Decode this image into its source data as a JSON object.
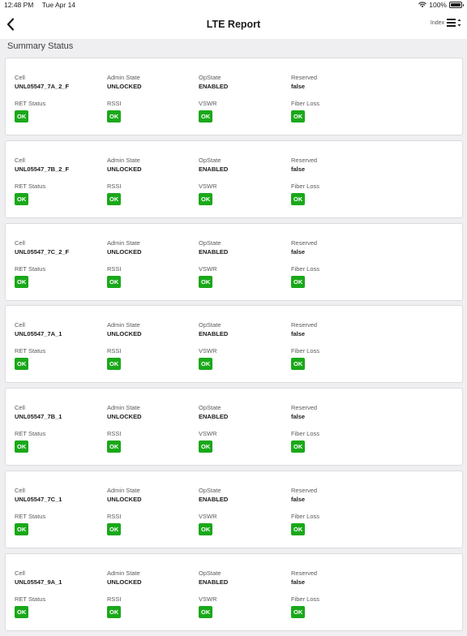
{
  "statusbar": {
    "time": "12:48 PM",
    "date": "Tue Apr 14",
    "battery": "100%"
  },
  "navbar": {
    "title": "LTE Report",
    "index_label": "Index"
  },
  "section_title": "Summary Status",
  "labels": {
    "cell": "Cell",
    "admin_state": "Admin State",
    "opstate": "OpState",
    "reserved": "Reserved",
    "ret_status": "RET Status",
    "rssi": "RSSI",
    "vswr": "VSWR",
    "fiber_loss": "Fiber Loss"
  },
  "colors": {
    "ok_badge": "#1aa81a"
  },
  "cards": [
    {
      "cell": "UNL05547_7A_2_F",
      "admin_state": "UNLOCKED",
      "opstate": "ENABLED",
      "reserved": "false",
      "ret_status": "OK",
      "rssi": "OK",
      "vswr": "OK",
      "fiber_loss": "OK"
    },
    {
      "cell": "UNL05547_7B_2_F",
      "admin_state": "UNLOCKED",
      "opstate": "ENABLED",
      "reserved": "false",
      "ret_status": "OK",
      "rssi": "OK",
      "vswr": "OK",
      "fiber_loss": "OK"
    },
    {
      "cell": "UNL05547_7C_2_F",
      "admin_state": "UNLOCKED",
      "opstate": "ENABLED",
      "reserved": "false",
      "ret_status": "OK",
      "rssi": "OK",
      "vswr": "OK",
      "fiber_loss": "OK"
    },
    {
      "cell": "UNL05547_7A_1",
      "admin_state": "UNLOCKED",
      "opstate": "ENABLED",
      "reserved": "false",
      "ret_status": "OK",
      "rssi": "OK",
      "vswr": "OK",
      "fiber_loss": "OK"
    },
    {
      "cell": "UNL05547_7B_1",
      "admin_state": "UNLOCKED",
      "opstate": "ENABLED",
      "reserved": "false",
      "ret_status": "OK",
      "rssi": "OK",
      "vswr": "OK",
      "fiber_loss": "OK"
    },
    {
      "cell": "UNL05547_7C_1",
      "admin_state": "UNLOCKED",
      "opstate": "ENABLED",
      "reserved": "false",
      "ret_status": "OK",
      "rssi": "OK",
      "vswr": "OK",
      "fiber_loss": "OK"
    },
    {
      "cell": "UNL05547_9A_1",
      "admin_state": "UNLOCKED",
      "opstate": "ENABLED",
      "reserved": "false",
      "ret_status": "OK",
      "rssi": "OK",
      "vswr": "OK",
      "fiber_loss": "OK"
    }
  ]
}
